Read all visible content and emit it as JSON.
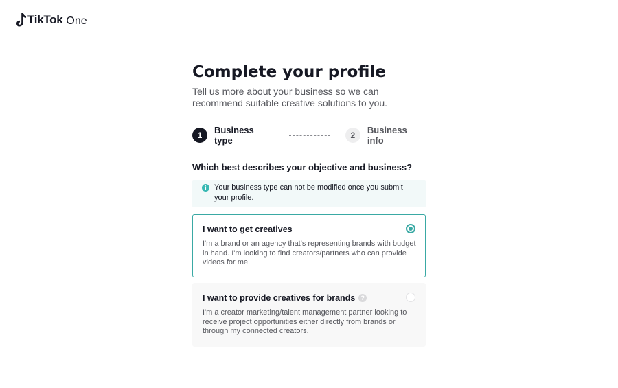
{
  "header": {
    "brand_name": "TikTok",
    "product_name": "One",
    "logo_icon": "tiktok-note-icon"
  },
  "page": {
    "title": "Complete your profile",
    "subtitle": "Tell us more about your business so we can recommend suitable creative solutions to you."
  },
  "stepper": {
    "steps": [
      {
        "number": "1",
        "label": "Business type",
        "state": "active"
      },
      {
        "number": "2",
        "label": "Business info",
        "state": "inactive"
      }
    ]
  },
  "question": "Which best describes your objective and business?",
  "notice": {
    "icon": "info-icon",
    "icon_glyph": "i",
    "text": "Your business type can not be modified once you submit your profile."
  },
  "options": [
    {
      "title": "I want to get creatives",
      "description": "I'm a brand or an agency that's representing brands with budget in hand. I'm looking to find creators/partners who can provide videos for me.",
      "selected": true
    },
    {
      "title": "I want to provide creatives for brands",
      "help_icon": "question-mark-icon",
      "help_glyph": "?",
      "description": "I'm a creator marketing/talent management partner looking to receive project opportunities either directly from brands or through my connected creators.",
      "selected": false
    }
  ],
  "colors": {
    "accent": "#3aa9a4",
    "text_primary": "#161823",
    "text_secondary": "#56575d",
    "notice_bg": "#f2f9f9",
    "option_bg": "#f8f8f8"
  }
}
